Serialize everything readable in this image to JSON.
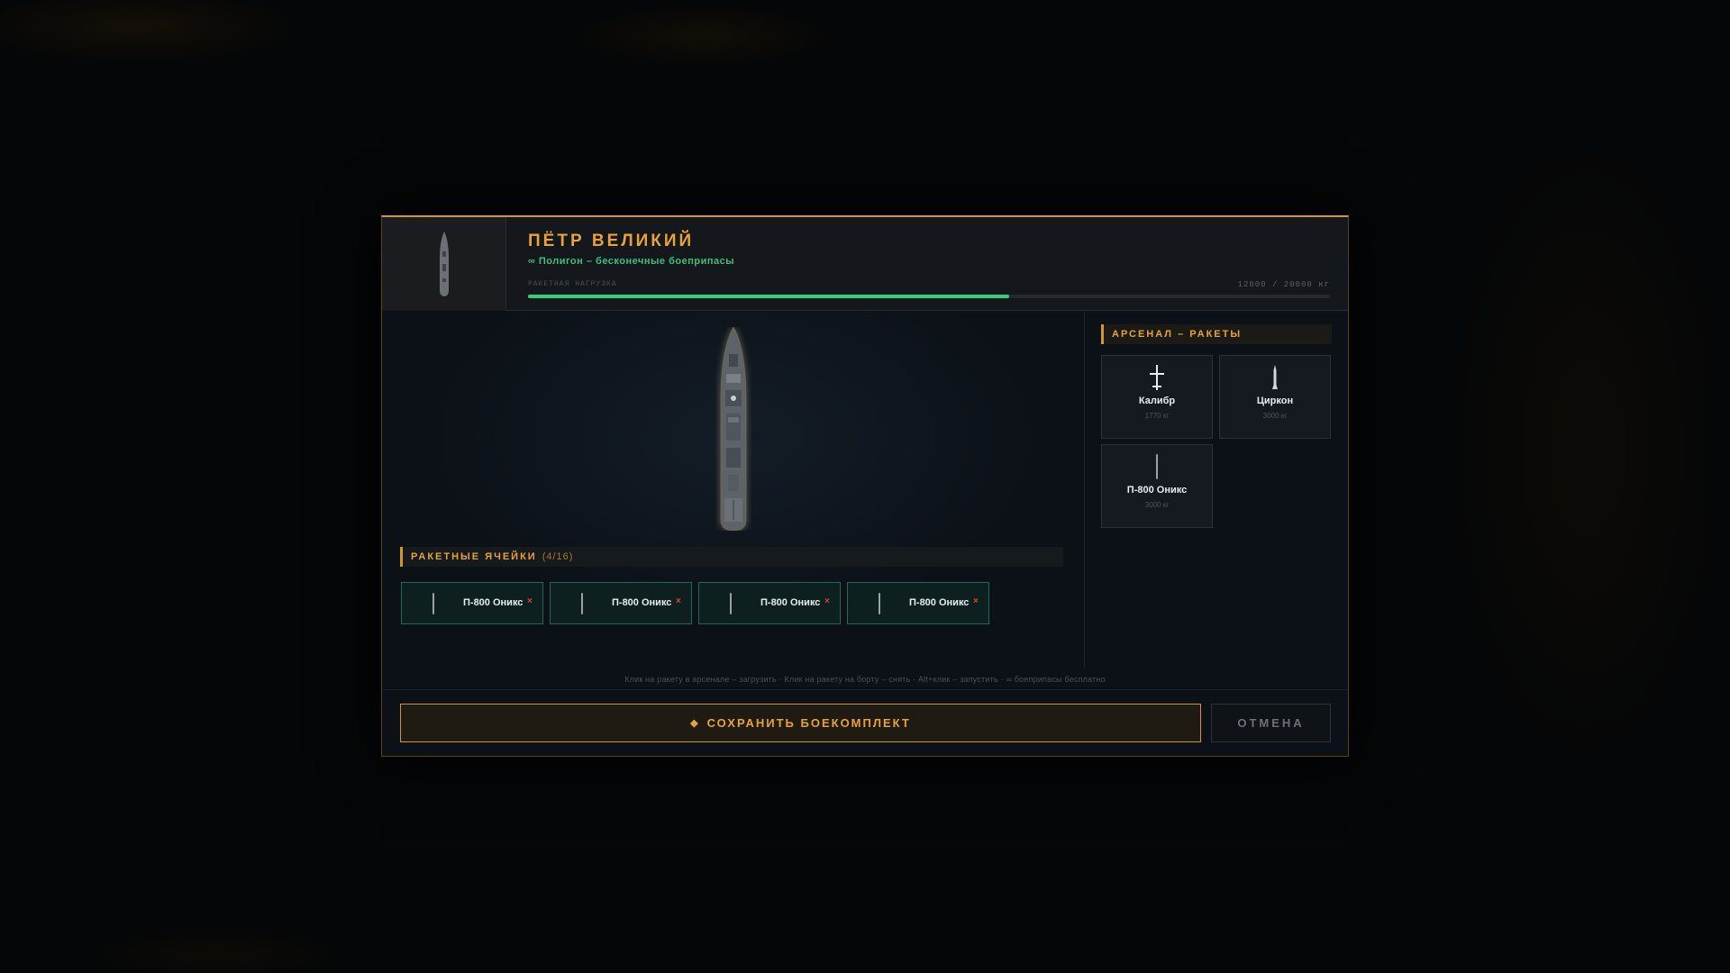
{
  "header": {
    "title": "ПЁТР ВЕЛИКИЙ",
    "subtitle": "∞ Полигон – бесконечные боеприпасы",
    "load_label": "РАКЕТНАЯ НАГРУЗКА",
    "load_value": "12000 / 20000 кг",
    "load_fraction": 0.6,
    "load_color": "#2fd27a"
  },
  "cells": {
    "title": "РАКЕТНЫЕ ЯЧЕЙКИ",
    "count": "(4/16)",
    "items": [
      {
        "label": "П-800 Оникс",
        "remove": "×"
      },
      {
        "label": "П-800 Оникс",
        "remove": "×"
      },
      {
        "label": "П-800 Оникс",
        "remove": "×"
      },
      {
        "label": "П-800 Оникс",
        "remove": "×"
      }
    ]
  },
  "arsenal": {
    "title": "АРСЕНАЛ – РАКЕТЫ",
    "items": [
      {
        "name": "Калибр",
        "weight": "1770 кг",
        "icon": "kalibr-missile-icon"
      },
      {
        "name": "Циркон",
        "weight": "3000 кг",
        "icon": "zircon-missile-icon"
      },
      {
        "name": "П-800 Оникс",
        "weight": "3000 кг",
        "icon": "oniks-missile-icon"
      }
    ]
  },
  "hint": "Клик на ракету в арсенале – загрузить · Клик на ракету на борту – снять · Alt+клик – запустить · ∞ боеприпасы бесплатно",
  "footer": {
    "save_label": "СОХРАНИТЬ БОЕКОМПЛЕКТ",
    "save_icon": "◆",
    "cancel_label": "ОТМЕНА"
  },
  "colors": {
    "accent": "#e7a33a",
    "green": "#3fbf7a",
    "remove": "#d9463b"
  }
}
